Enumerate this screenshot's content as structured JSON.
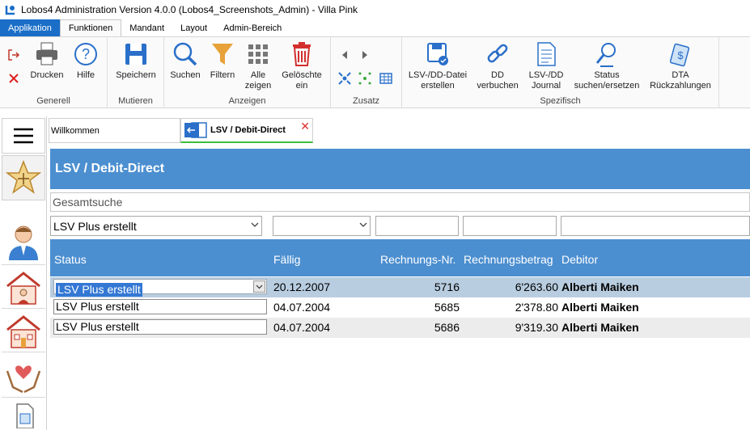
{
  "window": {
    "title": "Lobos4 Administration Version 4.0.0 (Lobos4_Screenshots_Admin) - Villa Pink"
  },
  "menu": {
    "items": [
      "Applikation",
      "Funktionen",
      "Mandant",
      "Layout",
      "Admin-Bereich"
    ]
  },
  "ribbon": {
    "generell": {
      "label": "Generell",
      "drucken": "Drucken",
      "hilfe": "Hilfe"
    },
    "mutieren": {
      "label": "Mutieren",
      "speichern": "Speichern"
    },
    "anzeigen": {
      "label": "Anzeigen",
      "suchen": "Suchen",
      "filtern": "Filtern",
      "alle_l1": "Alle",
      "alle_l2": "zeigen",
      "gel_l1": "Gelöschte",
      "gel_l2": "ein"
    },
    "zusatz": {
      "label": "Zusatz"
    },
    "spezifisch": {
      "label": "Spezifisch",
      "lsv_l1": "LSV-/DD-Datei",
      "lsv_l2": "erstellen",
      "dd_l1": "DD",
      "dd_l2": "verbuchen",
      "journal_l1": "LSV-/DD",
      "journal_l2": "Journal",
      "status_l1": "Status",
      "status_l2": "suchen/ersetzen",
      "dta_l1": "DTA",
      "dta_l2": "Rückzahlungen"
    }
  },
  "tabs": {
    "welcome": "Willkommen",
    "active": "LSV / Debit-Direct"
  },
  "page": {
    "title": "LSV / Debit-Direct",
    "search_placeholder": "Gesamtsuche"
  },
  "filters": {
    "status_value": "LSV Plus erstellt"
  },
  "grid": {
    "columns": {
      "status": "Status",
      "faellig": "Fällig",
      "rechnung": "Rechnungs-Nr.",
      "betrag": "Rechnungsbetrag",
      "debitor": "Debitor"
    },
    "rows": [
      {
        "status": "LSV Plus erstellt",
        "faellig": "20.12.2007",
        "rechnung": "5716",
        "betrag": "6'263.60",
        "debitor": "Alberti Maiken"
      },
      {
        "status": "LSV Plus erstellt",
        "faellig": "04.07.2004",
        "rechnung": "5685",
        "betrag": "2'378.80",
        "debitor": "Alberti Maiken"
      },
      {
        "status": "LSV Plus erstellt",
        "faellig": "04.07.2004",
        "rechnung": "5686",
        "betrag": "9'319.30",
        "debitor": "Alberti Maiken"
      }
    ]
  },
  "colors": {
    "accent": "#4c8fd0",
    "app_menu": "#1a6ec8",
    "selected_row": "#b8cde0"
  }
}
